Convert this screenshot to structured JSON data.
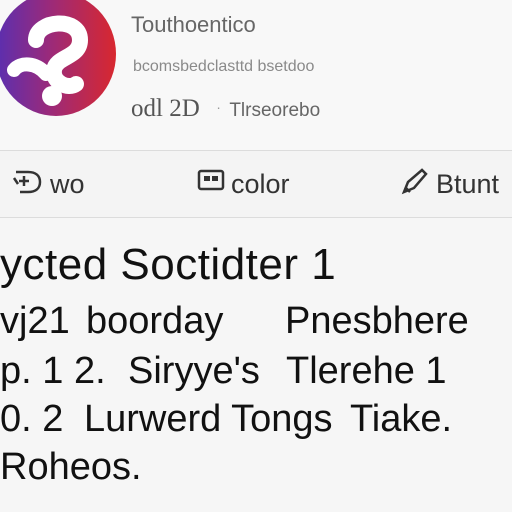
{
  "header": {
    "title": "Touthoentico",
    "subtitle": "bcomsbedclasttd bsetdoo",
    "date": "odl 2D",
    "separator": "·",
    "tag": "Tlrseorebo"
  },
  "toolbar": {
    "items": [
      {
        "label": "wo",
        "icon": "comment-icon"
      },
      {
        "label": "color",
        "icon": "palette-icon"
      },
      {
        "label": "Btunt",
        "icon": "pencil-icon"
      }
    ]
  },
  "content": {
    "heading": "ycted Soctidter 1",
    "rows": [
      {
        "a": "vj21",
        "b": "boorday",
        "c": "Pnesbhere"
      },
      {
        "a": "p. 1 2.",
        "b": "Siryye's",
        "c": "Tlerehe 1"
      },
      {
        "a": "0. 2",
        "b": "Lurwerd Tongs",
        "c": "Tiake."
      },
      {
        "a": "Roheos.",
        "b": "",
        "c": ""
      }
    ]
  },
  "colors": {
    "avatar_left": "#5a2fb0",
    "avatar_right": "#d8282f",
    "background": "#f6f6f6",
    "divider": "#dcdcdc"
  }
}
